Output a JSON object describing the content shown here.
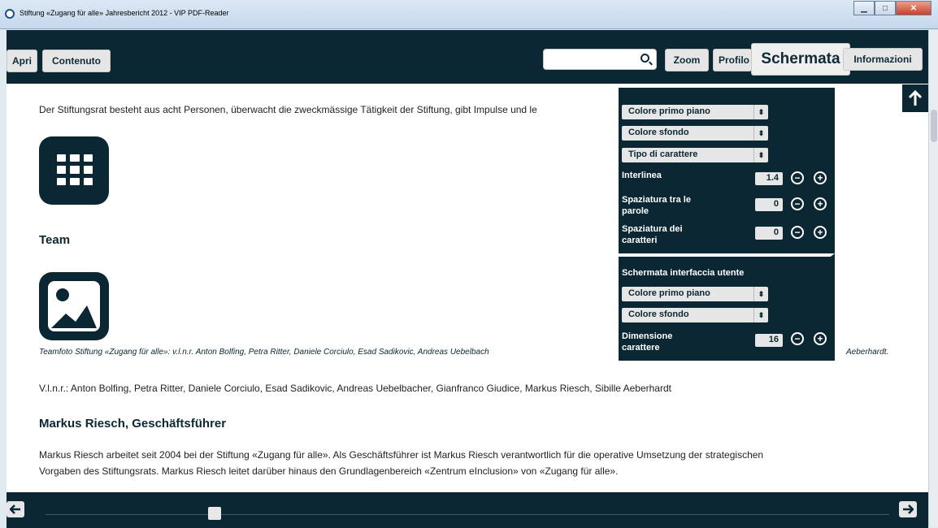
{
  "window": {
    "title": "Stiftung «Zugang für alle» Jahresbericht 2012 - VIP PDF-Reader",
    "controls": [
      "minimize",
      "maximize",
      "close"
    ]
  },
  "toolbar": {
    "apri_label": "Apri",
    "contenuto_label": "Contenuto",
    "search_value": "",
    "search_placeholder": "",
    "zoom_label": "Zoom",
    "profilo_label": "Profilo",
    "schermata_label": "Schermata",
    "informazioni_label": "Informazioni"
  },
  "content": {
    "intro_paragraph": "Der Stiftungsrat besteht aus acht Personen, überwacht die zweckmässige Tätigkeit der Stiftung, gibt Impulse und le",
    "team_heading": "Team",
    "photo_caption_left": "Teamfoto Stiftung «Zugang für alle»: v.l.n.r. Anton Bolfing, Petra Ritter, Daniele Corciulo, Esad Sadikovic, Andreas Uebelbach",
    "photo_caption_right": "Aeberhardt.",
    "names_paragraph": "V.l.n.r.: Anton Bolfing, Petra Ritter, Daniele Corciulo, Esad Sadikovic, Andreas Uebelbacher, Gianfranco Giudice, Markus Riesch, Sibille Aeberhardt",
    "person_heading": "Markus Riesch, Geschäftsführer",
    "bio_line1": "Markus Riesch arbeitet seit 2004 bei der Stiftung «Zugang für alle». Als Geschäftsführer ist Markus Riesch verantwortlich für die operative Umsetzung der strategischen",
    "bio_line2": "Vorgaben des Stiftungsrats. Markus Riesch leitet darüber hinaus den Grundlagenbereich «Zentrum eInclusion» von «Zugang für alle»."
  },
  "schermata_panel": {
    "document_section": {
      "foreground_select": "Colore primo piano",
      "background_select": "Colore sfondo",
      "font_select": "Tipo di carattere",
      "line_spacing_label": "Interlinea",
      "line_spacing_value": "1.4",
      "word_spacing_label_1": "Spaziatura tra le",
      "word_spacing_label_2": "parole",
      "word_spacing_value": "0",
      "char_spacing_label_1": "Spaziatura dei",
      "char_spacing_label_2": "caratteri",
      "char_spacing_value": "0"
    },
    "ui_section": {
      "heading": "Schermata interfaccia utente",
      "foreground_select": "Colore primo piano",
      "background_select": "Colore sfondo",
      "font_size_label_1": "Dimensione",
      "font_size_label_2": "carattere",
      "font_size_value": "16"
    },
    "select_arrow": "⬍",
    "minus_glyph": "−",
    "plus_glyph": "+"
  },
  "navigation": {
    "page_progress": 0.2
  },
  "colors": {
    "dark": "#0b2733",
    "content_bg": "#ffffff",
    "button_bg": "#e6e6e6"
  }
}
